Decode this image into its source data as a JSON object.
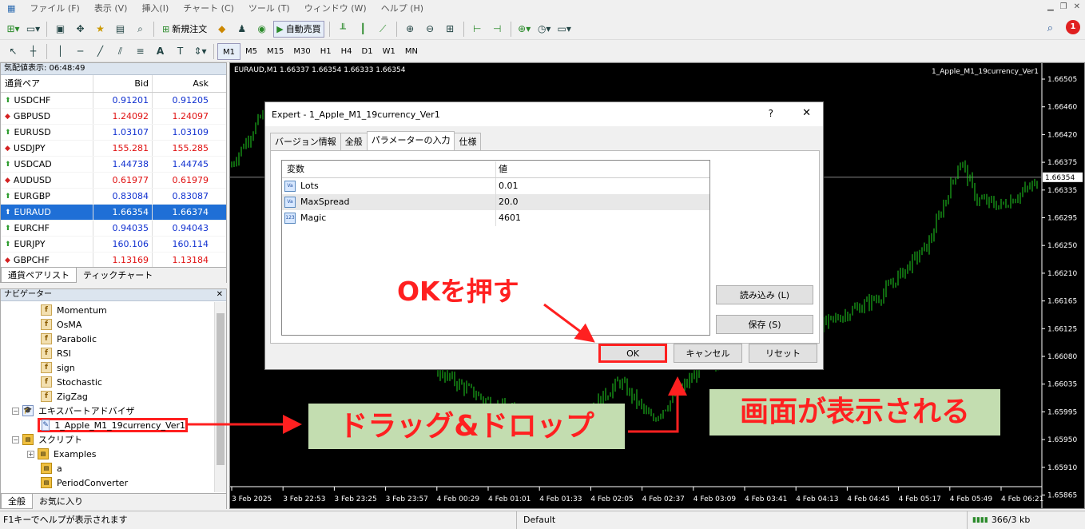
{
  "menu": {
    "items": [
      "ファイル (F)",
      "表示 (V)",
      "挿入(I)",
      "チャート (C)",
      "ツール (T)",
      "ウィンドウ (W)",
      "ヘルプ (H)"
    ]
  },
  "toolbar": {
    "new_order": "新規注文",
    "auto_trade": "自動売買",
    "timeframes": [
      "M1",
      "M5",
      "M15",
      "M30",
      "H1",
      "H4",
      "D1",
      "W1",
      "MN"
    ],
    "notification_count": "1"
  },
  "market_watch": {
    "title": "気配値表示: 06:48:49",
    "col_pair": "通貨ペア",
    "col_bid": "Bid",
    "col_ask": "Ask",
    "rows": [
      {
        "pair": "USDCHF",
        "bid": "0.91201",
        "ask": "0.91205",
        "dir": "up"
      },
      {
        "pair": "GBPUSD",
        "bid": "1.24092",
        "ask": "1.24097",
        "dir": "down"
      },
      {
        "pair": "EURUSD",
        "bid": "1.03107",
        "ask": "1.03109",
        "dir": "up"
      },
      {
        "pair": "USDJPY",
        "bid": "155.281",
        "ask": "155.285",
        "dir": "down"
      },
      {
        "pair": "USDCAD",
        "bid": "1.44738",
        "ask": "1.44745",
        "dir": "up"
      },
      {
        "pair": "AUDUSD",
        "bid": "0.61977",
        "ask": "0.61979",
        "dir": "down"
      },
      {
        "pair": "EURGBP",
        "bid": "0.83084",
        "ask": "0.83087",
        "dir": "up"
      },
      {
        "pair": "EURAUD",
        "bid": "1.66354",
        "ask": "1.66374",
        "dir": "selected"
      },
      {
        "pair": "EURCHF",
        "bid": "0.94035",
        "ask": "0.94043",
        "dir": "up"
      },
      {
        "pair": "EURJPY",
        "bid": "160.106",
        "ask": "160.114",
        "dir": "up"
      },
      {
        "pair": "GBPCHF",
        "bid": "1.13169",
        "ask": "1.13184",
        "dir": "down"
      }
    ],
    "tabs": [
      "通貨ペアリスト",
      "ティックチャート"
    ]
  },
  "navigator": {
    "title": "ナビゲーター",
    "indicators": [
      "Momentum",
      "OsMA",
      "Parabolic",
      "RSI",
      "sign",
      "Stochastic",
      "ZigZag"
    ],
    "experts_label": "エキスパートアドバイザ",
    "expert_item": "1_Apple_M1_19currency_Ver1",
    "scripts_label": "スクリプト",
    "scripts": [
      "Examples",
      "a",
      "PeriodConverter"
    ],
    "tabs": [
      "全般",
      "お気に入り"
    ]
  },
  "chart": {
    "header": "EURAUD,M1  1.66337 1.66354 1.66333 1.66354",
    "expert_label": "1_Apple_M1_19currency_Ver1",
    "prices": [
      "1.66505",
      "1.66460",
      "1.66420",
      "1.66375",
      "1.66335",
      "1.66295",
      "1.66250",
      "1.66210",
      "1.66165",
      "1.66125",
      "1.66080",
      "1.66035",
      "1.65995",
      "1.65950",
      "1.65910",
      "1.65865"
    ],
    "current_price": "1.66354",
    "times": [
      "3 Feb 2025",
      "3 Feb 22:53",
      "3 Feb 23:25",
      "3 Feb 23:57",
      "4 Feb 00:29",
      "4 Feb 01:01",
      "4 Feb 01:33",
      "4 Feb 02:05",
      "4 Feb 02:37",
      "4 Feb 03:09",
      "4 Feb 03:41",
      "4 Feb 04:13",
      "4 Feb 04:45",
      "4 Feb 05:17",
      "4 Feb 05:49",
      "4 Feb 06:21"
    ]
  },
  "dialog": {
    "title": "Expert - 1_Apple_M1_19currency_Ver1",
    "help": "?",
    "close": "✕",
    "tabs": [
      "バージョン情報",
      "全般",
      "パラメーターの入力",
      "仕様"
    ],
    "col_var": "変数",
    "col_val": "値",
    "params": [
      {
        "name": "Lots",
        "value": "0.01",
        "icon": "Va"
      },
      {
        "name": "MaxSpread",
        "value": "20.0",
        "icon": "Va"
      },
      {
        "name": "Magic",
        "value": "4601",
        "icon": "123"
      }
    ],
    "load_button": "読み込み (L)",
    "save_button": "保存 (S)",
    "ok_button": "OK",
    "cancel_button": "キャンセル",
    "reset_button": "リセット"
  },
  "annotations": {
    "press_ok": "OKを押す",
    "drag_drop": "ドラッグ&ドロップ",
    "screen_shown": "画面が表示される"
  },
  "status": {
    "help": "F1キーでヘルプが表示されます",
    "profile": "Default",
    "traffic": "366/3 kb"
  },
  "colors": {
    "accent_red": "#ff2020",
    "selection": "#1f6fd6",
    "candle": "#1fd11f"
  }
}
